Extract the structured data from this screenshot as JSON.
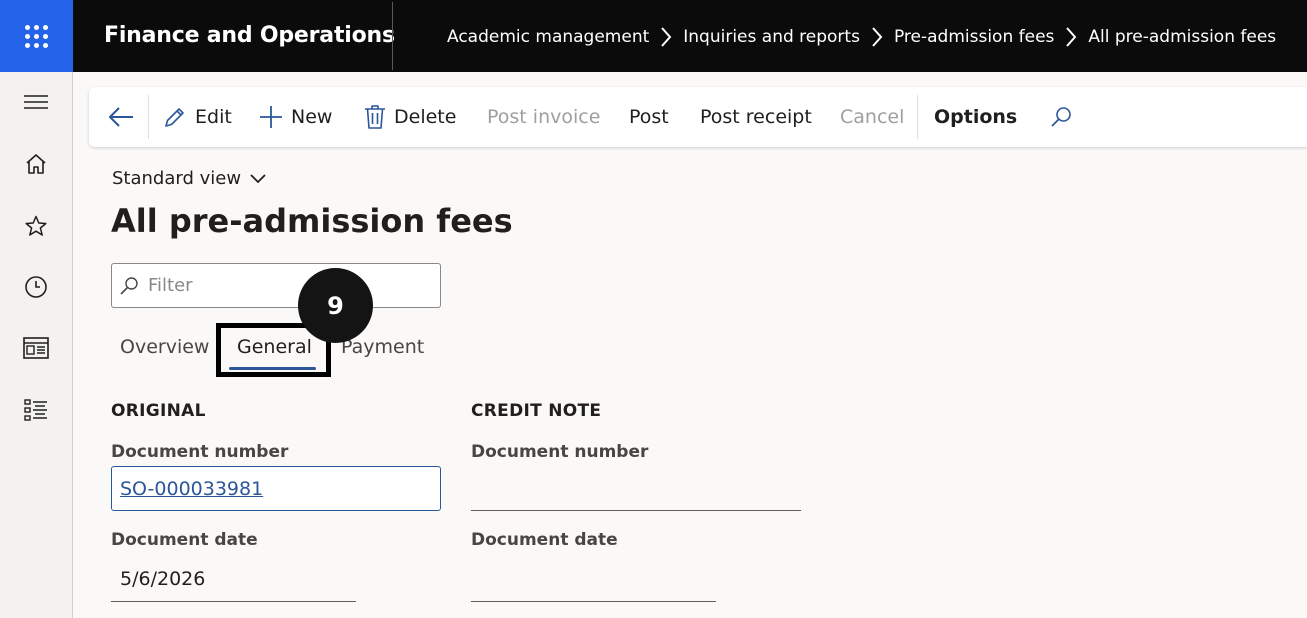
{
  "app": {
    "title": "Finance and Operations"
  },
  "breadcrumb": [
    {
      "label": "Academic management"
    },
    {
      "label": "Inquiries and reports"
    },
    {
      "label": "Pre-admission fees"
    },
    {
      "label": "All pre-admission fees"
    }
  ],
  "leftnav": {
    "items": [
      "hamburger-icon",
      "home-icon",
      "star-icon",
      "clock-icon",
      "workspace-icon",
      "list-icon"
    ]
  },
  "actionpane": {
    "edit": "Edit",
    "new": "New",
    "delete": "Delete",
    "post_invoice": "Post invoice",
    "post": "Post",
    "post_receipt": "Post receipt",
    "cancel": "Cancel",
    "options": "Options"
  },
  "view": {
    "selector": "Standard view"
  },
  "page": {
    "title": "All pre-admission fees"
  },
  "filter": {
    "placeholder": "Filter"
  },
  "step_badge": "9",
  "tabs": [
    {
      "label": "Overview"
    },
    {
      "label": "General",
      "active": true
    },
    {
      "label": "Payment"
    }
  ],
  "sections": {
    "original": {
      "heading": "ORIGINAL",
      "document_number_label": "Document number",
      "document_number_value": "SO-000033981",
      "document_date_label": "Document date",
      "document_date_value": "5/6/2026"
    },
    "credit_note": {
      "heading": "CREDIT NOTE",
      "document_number_label": "Document number",
      "document_number_value": "",
      "document_date_label": "Document date",
      "document_date_value": ""
    }
  },
  "colors": {
    "accent": "#2b579a",
    "waffle": "#2563eb",
    "topbar": "#0b0b0b"
  }
}
